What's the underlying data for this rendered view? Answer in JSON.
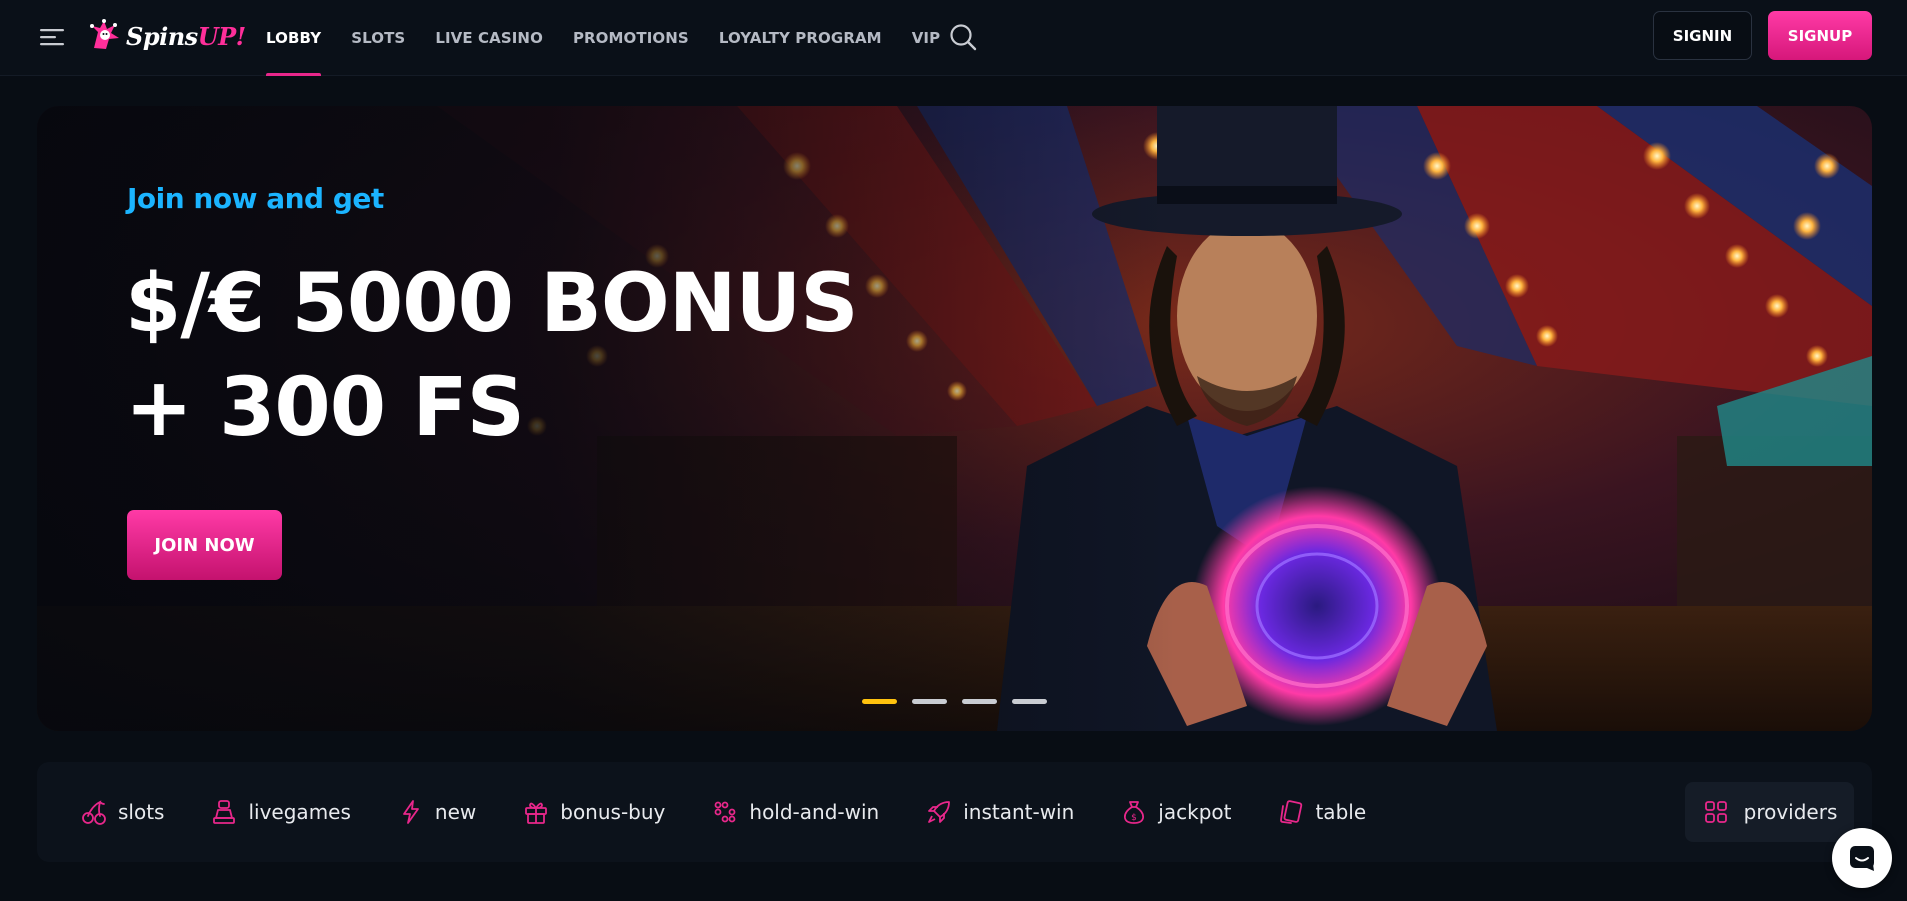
{
  "header": {
    "logo": {
      "word_white": "Spins",
      "word_pink": "UP!"
    },
    "nav": [
      {
        "label": "LOBBY",
        "active": true
      },
      {
        "label": "SLOTS",
        "active": false
      },
      {
        "label": "LIVE CASINO",
        "active": false
      },
      {
        "label": "PROMOTIONS",
        "active": false
      },
      {
        "label": "LOYALTY PROGRAM",
        "active": false
      },
      {
        "label": "VIP",
        "active": false
      }
    ],
    "icons": {
      "menu": "hamburger-menu-icon",
      "search": "search-icon"
    },
    "signin_label": "SIGNIN",
    "signup_label": "SIGNUP"
  },
  "hero": {
    "subtitle": "Join now and get",
    "title_line1": "$/€ 5000 BONUS",
    "title_line2": "+ 300 FS",
    "cta_label": "JOIN NOW",
    "slides_total": 4,
    "active_slide": 1
  },
  "categories": [
    {
      "label": "slots",
      "icon": "cherry-icon"
    },
    {
      "label": "livegames",
      "icon": "dealer-icon"
    },
    {
      "label": "new",
      "icon": "lightning-icon"
    },
    {
      "label": "bonus-buy",
      "icon": "gift-icon"
    },
    {
      "label": "hold-and-win",
      "icon": "grid-dots-icon"
    },
    {
      "label": "instant-win",
      "icon": "rocket-icon"
    },
    {
      "label": "jackpot",
      "icon": "money-bag-icon"
    },
    {
      "label": "table",
      "icon": "cards-icon"
    }
  ],
  "providers_label": "providers",
  "colors": {
    "accent_pink": "#e8278b",
    "accent_blue": "#1bb4ff",
    "slider_active": "#ffc20e",
    "background": "#080d14"
  }
}
